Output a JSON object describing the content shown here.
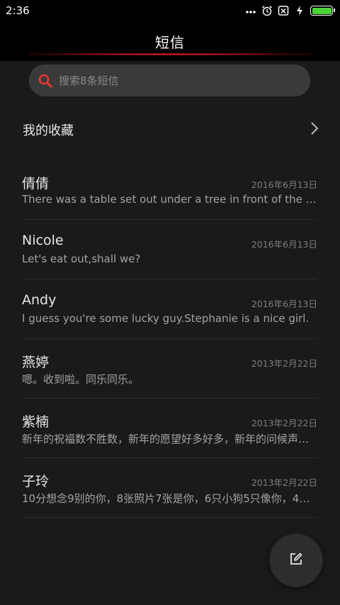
{
  "status_bar": {
    "time": "2:36",
    "icons": [
      "more-dots-icon",
      "alarm-icon",
      "notification-off-icon",
      "charging-icon",
      "battery-icon"
    ],
    "battery_level": 1.0,
    "battery_color": "#4cd137"
  },
  "header": {
    "title": "短信",
    "accent_color": "#ff2a2a"
  },
  "search": {
    "placeholder": "搜索8条短信",
    "icon": "search-icon",
    "icon_color": "#e53935"
  },
  "favorites": {
    "label": "我的收藏",
    "icon": "chevron-right-icon"
  },
  "threads": [
    {
      "name": "倩倩",
      "date": "2016年6月13日",
      "preview": "There was a table set out under a tree in front of the house"
    },
    {
      "name": "Nicole",
      "date": "2016年6月13日",
      "preview": "Let's eat out,shall we?"
    },
    {
      "name": "Andy",
      "date": "2016年6月13日",
      "preview": "I guess you're some lucky guy.Stephanie is a nice girl."
    },
    {
      "name": "燕婷",
      "date": "2013年2月22日",
      "preview": "嗯。收到啦。同乐同乐。"
    },
    {
      "name": "紫楠",
      "date": "2013年2月22日",
      "preview": "新年的祝福数不胜数，新年的愿望好多好多，新年的问候声声连"
    },
    {
      "name": "子玲",
      "date": "2013年2月22日",
      "preview": "10分想念9别的你，8张照片7张是你，6只小狗5只像你，4…"
    }
  ],
  "compose": {
    "icon": "compose-icon"
  }
}
